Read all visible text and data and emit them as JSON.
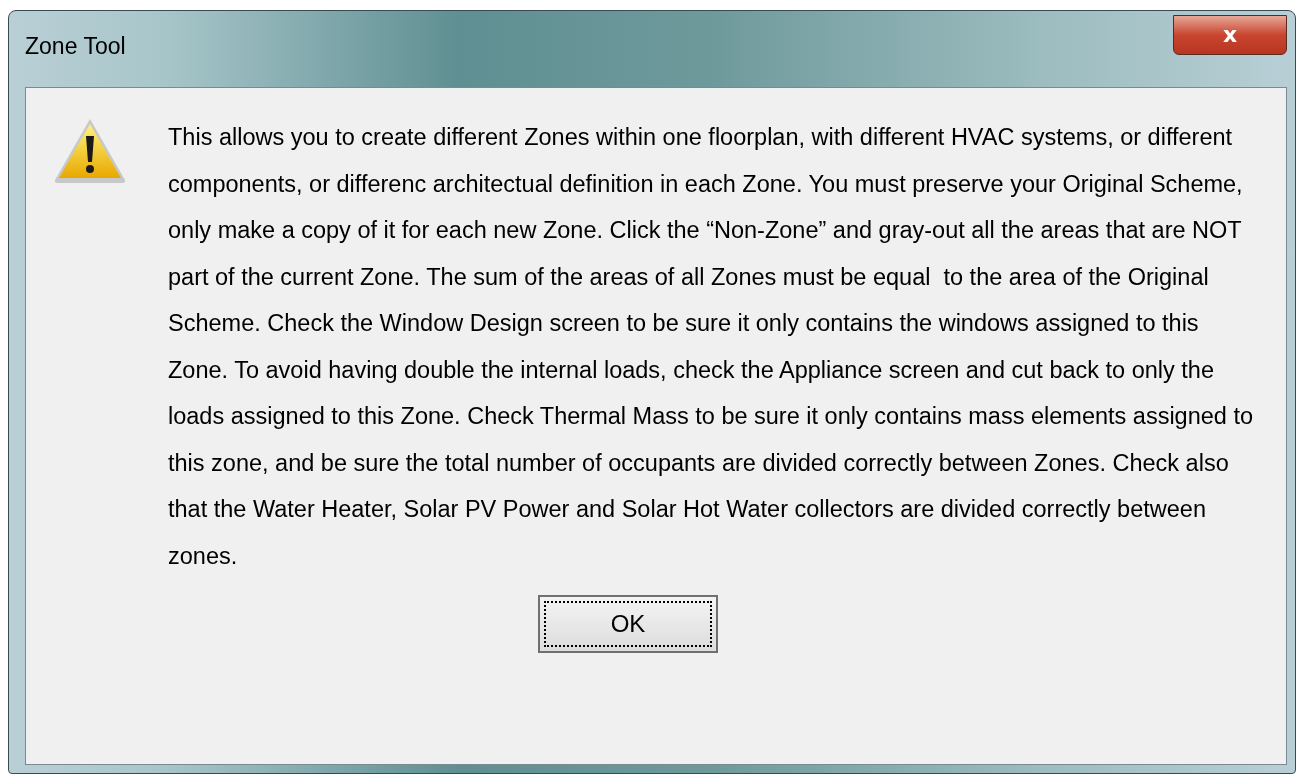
{
  "window": {
    "title": "Zone Tool",
    "close_label": "x"
  },
  "message": "This allows you to create different Zones within one floorplan, with different HVAC systems, or different components, or differenc architectual definition in each Zone. You must preserve your Original Scheme, only make a copy of it for each new Zone. Click the “Non-Zone” and gray-out all the areas that are NOT part of the current Zone. The sum of the areas of all Zones must be equal  to the area of the Original Scheme. Check the Window Design screen to be sure it only contains the windows assigned to this Zone. To avoid having double the internal loads, check the Appliance screen and cut back to only the loads assigned to this Zone. Check Thermal Mass to be sure it only contains mass elements assigned to this zone, and be sure the total number of occupants are divided correctly between Zones. Check also that the Water Heater, Solar PV Power and Solar Hot Water collectors are divided correctly between zones.",
  "icon": {
    "kind": "warning"
  },
  "buttons": [
    {
      "label": "OK",
      "focused": true
    }
  ]
}
